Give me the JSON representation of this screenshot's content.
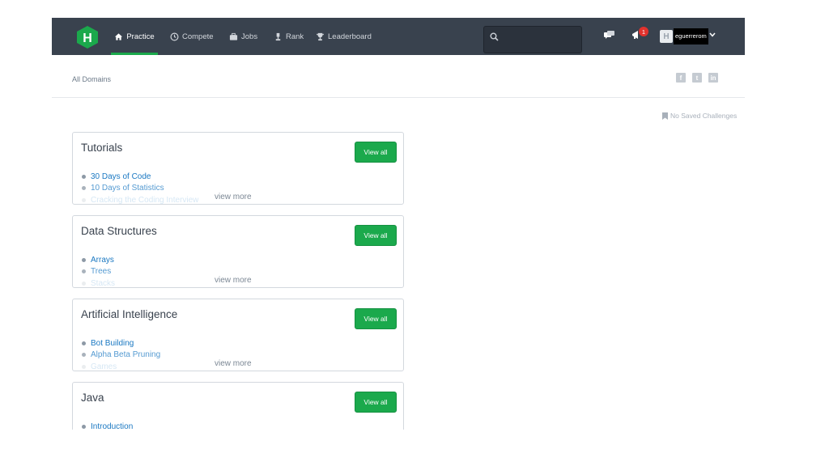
{
  "nav": {
    "items": [
      {
        "label": "Practice",
        "icon": "home-icon",
        "active": true
      },
      {
        "label": "Compete",
        "icon": "clock-icon"
      },
      {
        "label": "Jobs",
        "icon": "briefcase-icon"
      },
      {
        "label": "Rank",
        "icon": "trophy-small-icon"
      },
      {
        "label": "Leaderboard",
        "icon": "trophy-icon"
      }
    ],
    "search_placeholder": "",
    "notification_count": "1",
    "avatar_letter": "H",
    "username": "eguerrerom"
  },
  "breadcrumb": "All Domains",
  "social": [
    {
      "icon": "facebook-icon",
      "glyph": "f"
    },
    {
      "icon": "twitter-icon",
      "glyph": "t"
    },
    {
      "icon": "linkedin-icon",
      "glyph": "in"
    }
  ],
  "saved_challenges": "No Saved Challenges",
  "view_all_label": "View all",
  "view_more_label": "view more",
  "cards": [
    {
      "title": "Tutorials",
      "items": [
        "30 Days of Code",
        "10 Days of Statistics",
        "Cracking the Coding Interview"
      ]
    },
    {
      "title": "Data Structures",
      "items": [
        "Arrays",
        "Trees",
        "Stacks"
      ]
    },
    {
      "title": "Artificial Intelligence",
      "items": [
        "Bot Building",
        "Alpha Beta Pruning",
        "Games"
      ]
    },
    {
      "title": "Java",
      "items": [
        "Introduction"
      ]
    }
  ],
  "colors": {
    "accent": "#1ba94c",
    "navbar": "#39424e",
    "link": "#1a78c2"
  }
}
